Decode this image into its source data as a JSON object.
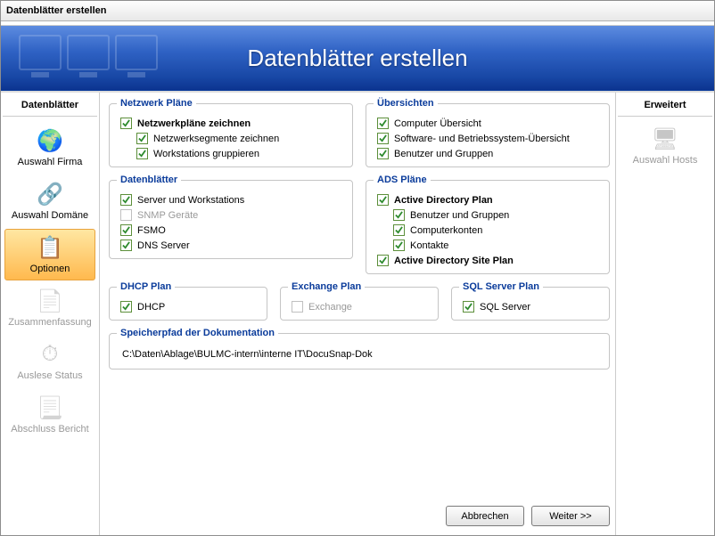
{
  "window": {
    "title": "Datenblätter erstellen"
  },
  "banner": {
    "heading": "Datenblätter erstellen"
  },
  "leftSidebar": {
    "header": "Datenblätter",
    "items": [
      {
        "id": "firma",
        "label": "Auswahl Firma",
        "icon": "🌍",
        "state": "enabled"
      },
      {
        "id": "domaene",
        "label": "Auswahl Domäne",
        "icon": "🔗",
        "state": "enabled"
      },
      {
        "id": "optionen",
        "label": "Optionen",
        "icon": "📋",
        "state": "selected"
      },
      {
        "id": "zusammen",
        "label": "Zusammenfassung",
        "icon": "📄",
        "state": "disabled"
      },
      {
        "id": "auslese",
        "label": "Auslese Status",
        "icon": "⏱",
        "state": "disabled"
      },
      {
        "id": "bericht",
        "label": "Abschluss Bericht",
        "icon": "📃",
        "state": "disabled"
      }
    ]
  },
  "rightSidebar": {
    "header": "Erweitert",
    "items": [
      {
        "id": "auswahl-hosts",
        "label": "Auswahl Hosts",
        "icon": "🖥",
        "state": "disabled"
      }
    ]
  },
  "groups": {
    "netzplaene": {
      "legend": "Netzwerk Pläne"
    },
    "uebersichten": {
      "legend": "Übersichten"
    },
    "datenblaetter": {
      "legend": "Datenblätter"
    },
    "adsplaene": {
      "legend": "ADS Pläne"
    },
    "dhcp": {
      "legend": "DHCP Plan"
    },
    "exchange": {
      "legend": "Exchange Plan"
    },
    "sql": {
      "legend": "SQL Server Plan"
    },
    "speicherpfad": {
      "legend": "Speicherpfad der Dokumentation"
    }
  },
  "checks": {
    "netzplaene_zeichnen": {
      "label": "Netzwerkpläne zeichnen",
      "checked": true
    },
    "netzsegmente": {
      "label": "Netzwerksegmente zeichnen",
      "checked": true
    },
    "workstations_grp": {
      "label": "Workstations gruppieren",
      "checked": true
    },
    "comp_uebersicht": {
      "label": "Computer Übersicht",
      "checked": true
    },
    "sw_bs_uebersicht": {
      "label": "Software-  und Betriebssystem-Übersicht",
      "checked": true
    },
    "benutzer_gruppen_u": {
      "label": "Benutzer und Gruppen",
      "checked": true
    },
    "server_ws": {
      "label": "Server und Workstations",
      "checked": true
    },
    "snmp": {
      "label": "SNMP Geräte",
      "checked": false,
      "disabled": true
    },
    "fsmo": {
      "label": "FSMO",
      "checked": true
    },
    "dns": {
      "label": "DNS Server",
      "checked": true
    },
    "ad_plan": {
      "label": "Active Directory Plan",
      "checked": true
    },
    "bg_ad": {
      "label": "Benutzer und Gruppen",
      "checked": true
    },
    "compkonten": {
      "label": "Computerkonten",
      "checked": true
    },
    "kontakte": {
      "label": "Kontakte",
      "checked": true
    },
    "ad_site": {
      "label": "Active Directory Site Plan",
      "checked": true
    },
    "dhcp": {
      "label": "DHCP",
      "checked": true
    },
    "exchange": {
      "label": "Exchange",
      "checked": false,
      "disabled": true
    },
    "sqlserver": {
      "label": "SQL Server",
      "checked": true
    }
  },
  "path": {
    "value": "C:\\Daten\\Ablage\\BULMC-intern\\interne IT\\DocuSnap-Dok"
  },
  "buttons": {
    "cancel": "Abbrechen",
    "next": "Weiter >>"
  }
}
